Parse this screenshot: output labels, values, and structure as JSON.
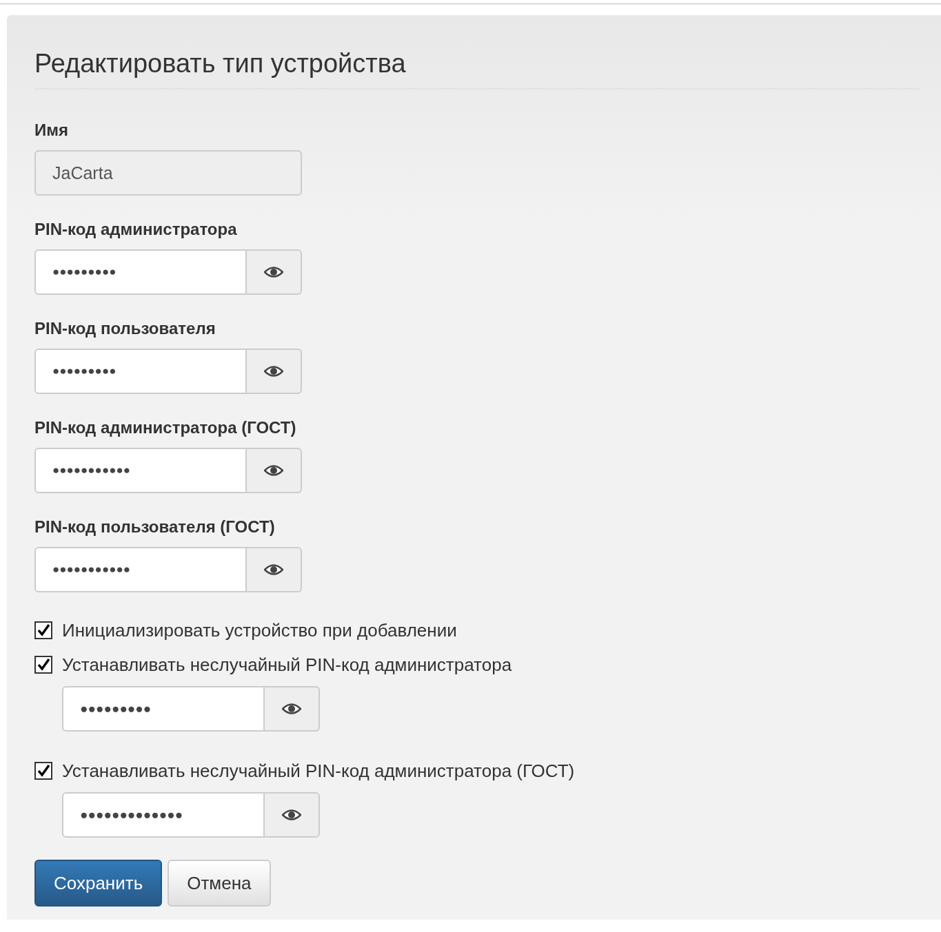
{
  "title": "Редактировать тип устройства",
  "fields": [
    {
      "kind": "text",
      "label": "Имя",
      "value": "JaCarta",
      "disabled": true
    },
    {
      "kind": "password",
      "label": "PIN-код администратора",
      "value": "●●●●●●●●●"
    },
    {
      "kind": "password",
      "label": "PIN-код пользователя",
      "value": "●●●●●●●●●"
    },
    {
      "kind": "password",
      "label": "PIN-код администратора (ГОСТ)",
      "value": "●●●●●●●●●●●"
    },
    {
      "kind": "password",
      "label": "PIN-код пользователя (ГОСТ)",
      "value": "●●●●●●●●●●●"
    }
  ],
  "options": [
    {
      "label": "Инициализировать устройство при добавлении",
      "checked": true
    },
    {
      "label": "Устанавливать неслучайный PIN-код администратора",
      "checked": true,
      "field": {
        "value": "●●●●●●●●●"
      }
    },
    {
      "label": "Устанавливать неслучайный PIN-код администратора (ГОСТ)",
      "checked": true,
      "field": {
        "value": "●●●●●●●●●●●●●"
      }
    }
  ],
  "buttons": [
    {
      "label": "Сохранить",
      "kind": "primary"
    },
    {
      "label": "Отмена",
      "kind": "default"
    }
  ]
}
